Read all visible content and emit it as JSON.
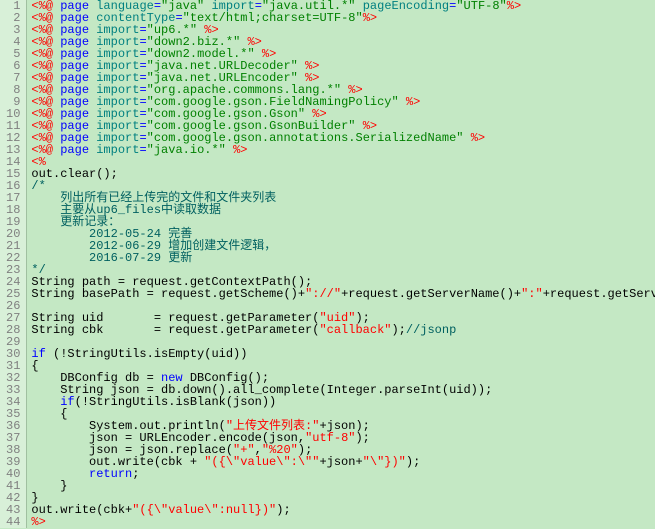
{
  "lines": [
    {
      "n": 1,
      "segs": [
        {
          "t": "<%@",
          "c": "red"
        },
        {
          "t": " page ",
          "c": "blue"
        },
        {
          "t": "language",
          "c": "teal"
        },
        {
          "t": "=",
          "c": "blue"
        },
        {
          "t": "\"java\"",
          "c": "green"
        },
        {
          "t": " import",
          "c": "teal"
        },
        {
          "t": "=",
          "c": "blue"
        },
        {
          "t": "\"java.util.*\"",
          "c": "green"
        },
        {
          "t": " pageEncoding",
          "c": "teal"
        },
        {
          "t": "=",
          "c": "blue"
        },
        {
          "t": "\"UTF-8\"",
          "c": "green"
        },
        {
          "t": "%>",
          "c": "red"
        }
      ]
    },
    {
      "n": 2,
      "segs": [
        {
          "t": "<%@",
          "c": "red"
        },
        {
          "t": " page ",
          "c": "blue"
        },
        {
          "t": "contentType",
          "c": "teal"
        },
        {
          "t": "=",
          "c": "blue"
        },
        {
          "t": "\"text/html;charset=UTF-8\"",
          "c": "green"
        },
        {
          "t": "%>",
          "c": "red"
        }
      ]
    },
    {
      "n": 3,
      "segs": [
        {
          "t": "<%@",
          "c": "red"
        },
        {
          "t": " page ",
          "c": "blue"
        },
        {
          "t": "import",
          "c": "teal"
        },
        {
          "t": "=",
          "c": "blue"
        },
        {
          "t": "\"up6.*\"",
          "c": "green"
        },
        {
          "t": " %>",
          "c": "red"
        }
      ]
    },
    {
      "n": 4,
      "segs": [
        {
          "t": "<%@",
          "c": "red"
        },
        {
          "t": " page ",
          "c": "blue"
        },
        {
          "t": "import",
          "c": "teal"
        },
        {
          "t": "=",
          "c": "blue"
        },
        {
          "t": "\"down2.biz.*\"",
          "c": "green"
        },
        {
          "t": " %>",
          "c": "red"
        }
      ]
    },
    {
      "n": 5,
      "segs": [
        {
          "t": "<%@",
          "c": "red"
        },
        {
          "t": " page ",
          "c": "blue"
        },
        {
          "t": "import",
          "c": "teal"
        },
        {
          "t": "=",
          "c": "blue"
        },
        {
          "t": "\"down2.model.*\"",
          "c": "green"
        },
        {
          "t": " %>",
          "c": "red"
        }
      ]
    },
    {
      "n": 6,
      "segs": [
        {
          "t": "<%@",
          "c": "red"
        },
        {
          "t": " page ",
          "c": "blue"
        },
        {
          "t": "import",
          "c": "teal"
        },
        {
          "t": "=",
          "c": "blue"
        },
        {
          "t": "\"java.net.URLDecoder\"",
          "c": "green"
        },
        {
          "t": " %>",
          "c": "red"
        }
      ]
    },
    {
      "n": 7,
      "segs": [
        {
          "t": "<%@",
          "c": "red"
        },
        {
          "t": " page ",
          "c": "blue"
        },
        {
          "t": "import",
          "c": "teal"
        },
        {
          "t": "=",
          "c": "blue"
        },
        {
          "t": "\"java.net.URLEncoder\"",
          "c": "green"
        },
        {
          "t": " %>",
          "c": "red"
        }
      ]
    },
    {
      "n": 8,
      "segs": [
        {
          "t": "<%@",
          "c": "red"
        },
        {
          "t": " page ",
          "c": "blue"
        },
        {
          "t": "import",
          "c": "teal"
        },
        {
          "t": "=",
          "c": "blue"
        },
        {
          "t": "\"org.apache.commons.lang.*\"",
          "c": "green"
        },
        {
          "t": " %>",
          "c": "red"
        }
      ]
    },
    {
      "n": 9,
      "segs": [
        {
          "t": "<%@",
          "c": "red"
        },
        {
          "t": " page ",
          "c": "blue"
        },
        {
          "t": "import",
          "c": "teal"
        },
        {
          "t": "=",
          "c": "blue"
        },
        {
          "t": "\"com.google.gson.FieldNamingPolicy\"",
          "c": "green"
        },
        {
          "t": " %>",
          "c": "red"
        }
      ]
    },
    {
      "n": 10,
      "segs": [
        {
          "t": "<%@",
          "c": "red"
        },
        {
          "t": " page ",
          "c": "blue"
        },
        {
          "t": "import",
          "c": "teal"
        },
        {
          "t": "=",
          "c": "blue"
        },
        {
          "t": "\"com.google.gson.Gson\"",
          "c": "green"
        },
        {
          "t": " %>",
          "c": "red"
        }
      ]
    },
    {
      "n": 11,
      "segs": [
        {
          "t": "<%@",
          "c": "red"
        },
        {
          "t": " page ",
          "c": "blue"
        },
        {
          "t": "import",
          "c": "teal"
        },
        {
          "t": "=",
          "c": "blue"
        },
        {
          "t": "\"com.google.gson.GsonBuilder\"",
          "c": "green"
        },
        {
          "t": " %>",
          "c": "red"
        }
      ]
    },
    {
      "n": 12,
      "segs": [
        {
          "t": "<%@",
          "c": "red"
        },
        {
          "t": " page ",
          "c": "blue"
        },
        {
          "t": "import",
          "c": "teal"
        },
        {
          "t": "=",
          "c": "blue"
        },
        {
          "t": "\"com.google.gson.annotations.SerializedName\"",
          "c": "green"
        },
        {
          "t": " %>",
          "c": "red"
        }
      ]
    },
    {
      "n": 13,
      "segs": [
        {
          "t": "<%@",
          "c": "red"
        },
        {
          "t": " page ",
          "c": "blue"
        },
        {
          "t": "import",
          "c": "teal"
        },
        {
          "t": "=",
          "c": "blue"
        },
        {
          "t": "\"java.io.*\"",
          "c": "green"
        },
        {
          "t": " %>",
          "c": "red"
        }
      ]
    },
    {
      "n": 14,
      "segs": [
        {
          "t": "<%",
          "c": "red"
        }
      ],
      "fold": "-"
    },
    {
      "n": 15,
      "segs": [
        {
          "t": "out.clear();",
          "c": "black"
        }
      ]
    },
    {
      "n": 16,
      "segs": [
        {
          "t": "/*",
          "c": "dkteal"
        }
      ]
    },
    {
      "n": 17,
      "segs": [
        {
          "t": "    列出所有已经上传完的文件和文件夹列表",
          "c": "dkteal"
        }
      ]
    },
    {
      "n": 18,
      "segs": [
        {
          "t": "    主要从up6_files中读取数据",
          "c": "dkteal"
        }
      ]
    },
    {
      "n": 19,
      "segs": [
        {
          "t": "    更新记录：",
          "c": "dkteal"
        }
      ]
    },
    {
      "n": 20,
      "segs": [
        {
          "t": "        2012-05-24 完善",
          "c": "dkteal"
        }
      ]
    },
    {
      "n": 21,
      "segs": [
        {
          "t": "        2012-06-29 增加创建文件逻辑，",
          "c": "dkteal"
        }
      ]
    },
    {
      "n": 22,
      "segs": [
        {
          "t": "        2016-07-29 更新",
          "c": "dkteal"
        }
      ]
    },
    {
      "n": 23,
      "segs": [
        {
          "t": "*/",
          "c": "dkteal"
        }
      ]
    },
    {
      "n": 24,
      "segs": [
        {
          "t": "String path = request.getContextPath();",
          "c": "black"
        }
      ]
    },
    {
      "n": 25,
      "segs": [
        {
          "t": "String basePath = request.getScheme()+",
          "c": "black"
        },
        {
          "t": "\"://\"",
          "c": "red"
        },
        {
          "t": "+request.getServerName()+",
          "c": "black"
        },
        {
          "t": "\":\"",
          "c": "red"
        },
        {
          "t": "+request.getServerPort()+path+",
          "c": "black"
        },
        {
          "t": "\"/\"",
          "c": "red"
        },
        {
          "t": ";",
          "c": "black"
        }
      ]
    },
    {
      "n": 26,
      "segs": [
        {
          "t": "",
          "c": "black"
        }
      ]
    },
    {
      "n": 27,
      "segs": [
        {
          "t": "String uid       = request.getParameter(",
          "c": "black"
        },
        {
          "t": "\"uid\"",
          "c": "red"
        },
        {
          "t": ");",
          "c": "black"
        }
      ]
    },
    {
      "n": 28,
      "segs": [
        {
          "t": "String cbk       = request.getParameter(",
          "c": "black"
        },
        {
          "t": "\"callback\"",
          "c": "red"
        },
        {
          "t": ");",
          "c": "black"
        },
        {
          "t": "//jsonp",
          "c": "dkteal"
        }
      ]
    },
    {
      "n": 29,
      "segs": [
        {
          "t": "",
          "c": "black"
        }
      ]
    },
    {
      "n": 30,
      "segs": [
        {
          "t": "if",
          "c": "blue"
        },
        {
          "t": " (!StringUtils.isEmpty(uid))",
          "c": "black"
        }
      ]
    },
    {
      "n": 31,
      "segs": [
        {
          "t": "{",
          "c": "black"
        }
      ]
    },
    {
      "n": 32,
      "segs": [
        {
          "t": "    DBConfig db = ",
          "c": "black"
        },
        {
          "t": "new",
          "c": "blue"
        },
        {
          "t": " DBConfig();",
          "c": "black"
        }
      ]
    },
    {
      "n": 33,
      "segs": [
        {
          "t": "    String json = db.down().all_complete(Integer.parseInt(uid));",
          "c": "black"
        }
      ]
    },
    {
      "n": 34,
      "segs": [
        {
          "t": "    ",
          "c": "black"
        },
        {
          "t": "if",
          "c": "blue"
        },
        {
          "t": "(!StringUtils.isBlank(json))",
          "c": "black"
        }
      ]
    },
    {
      "n": 35,
      "segs": [
        {
          "t": "    {",
          "c": "black"
        }
      ]
    },
    {
      "n": 36,
      "segs": [
        {
          "t": "        System.out.println(",
          "c": "black"
        },
        {
          "t": "\"上传文件列表:\"",
          "c": "red"
        },
        {
          "t": "+json);",
          "c": "black"
        }
      ]
    },
    {
      "n": 37,
      "segs": [
        {
          "t": "        json = URLEncoder.encode(json,",
          "c": "black"
        },
        {
          "t": "\"utf-8\"",
          "c": "red"
        },
        {
          "t": ");",
          "c": "black"
        }
      ]
    },
    {
      "n": 38,
      "segs": [
        {
          "t": "        json = json.replace(",
          "c": "black"
        },
        {
          "t": "\"+\"",
          "c": "red"
        },
        {
          "t": ",",
          "c": "black"
        },
        {
          "t": "\"%20\"",
          "c": "red"
        },
        {
          "t": ");",
          "c": "black"
        }
      ]
    },
    {
      "n": 39,
      "segs": [
        {
          "t": "        out.write(cbk + ",
          "c": "black"
        },
        {
          "t": "\"({\\\"value\\\":\\\"\"",
          "c": "red"
        },
        {
          "t": "+json+",
          "c": "black"
        },
        {
          "t": "\"\\\"})\"",
          "c": "red"
        },
        {
          "t": ");",
          "c": "black"
        }
      ]
    },
    {
      "n": 40,
      "segs": [
        {
          "t": "        ",
          "c": "black"
        },
        {
          "t": "return",
          "c": "blue"
        },
        {
          "t": ";",
          "c": "black"
        }
      ]
    },
    {
      "n": 41,
      "segs": [
        {
          "t": "    }",
          "c": "black"
        }
      ]
    },
    {
      "n": 42,
      "segs": [
        {
          "t": "}",
          "c": "black"
        }
      ]
    },
    {
      "n": 43,
      "segs": [
        {
          "t": "out.write(cbk+",
          "c": "black"
        },
        {
          "t": "\"({\\\"value\\\":null})\"",
          "c": "red"
        },
        {
          "t": ");",
          "c": "black"
        }
      ]
    },
    {
      "n": 44,
      "segs": [
        {
          "t": "%>",
          "c": "red"
        }
      ]
    }
  ]
}
